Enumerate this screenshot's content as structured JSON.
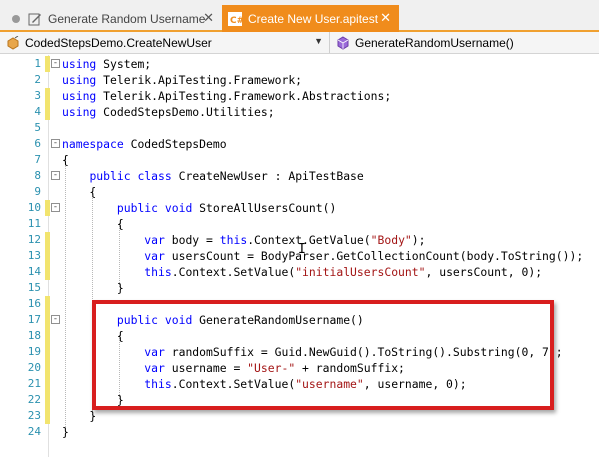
{
  "tabs": [
    {
      "label": "Generate Random Username",
      "active": false
    },
    {
      "label": "Create New User.apitest",
      "active": true
    }
  ],
  "navbar": {
    "class_selector": "CodedStepsDemo.CreateNewUser",
    "member_selector": "GenerateRandomUsername()"
  },
  "colors": {
    "accent": "#f08c1c",
    "keyword": "#0000ff",
    "string": "#a31515",
    "line_number": "#2b91af",
    "highlight": "#d81e1e",
    "changed_marker": "#f2e46e"
  },
  "lines": [
    {
      "num": "1",
      "changed": true,
      "fold": "-",
      "tokens": [
        {
          "t": "using",
          "k": "kw"
        },
        {
          "t": " System;"
        }
      ]
    },
    {
      "num": "2",
      "changed": false,
      "fold": "",
      "tokens": [
        {
          "t": "using",
          "k": "kw"
        },
        {
          "t": " Telerik.ApiTesting.Framework;"
        }
      ]
    },
    {
      "num": "3",
      "changed": true,
      "fold": "",
      "tokens": [
        {
          "t": "using",
          "k": "kw"
        },
        {
          "t": " Telerik.ApiTesting.Framework.Abstractions;"
        }
      ]
    },
    {
      "num": "4",
      "changed": true,
      "fold": "",
      "tokens": [
        {
          "t": "using",
          "k": "kw"
        },
        {
          "t": " CodedStepsDemo.Utilities;"
        }
      ]
    },
    {
      "num": "5",
      "changed": false,
      "fold": "",
      "tokens": []
    },
    {
      "num": "6",
      "changed": false,
      "fold": "-",
      "tokens": [
        {
          "t": "namespace",
          "k": "kw"
        },
        {
          "t": " CodedStepsDemo"
        }
      ]
    },
    {
      "num": "7",
      "changed": false,
      "fold": "",
      "tokens": [
        {
          "t": "{"
        }
      ]
    },
    {
      "num": "8",
      "changed": false,
      "fold": "-",
      "tokens": [
        {
          "t": "    "
        },
        {
          "t": "public",
          "k": "kw"
        },
        {
          "t": " "
        },
        {
          "t": "class",
          "k": "kw"
        },
        {
          "t": " CreateNewUser : ApiTestBase"
        }
      ]
    },
    {
      "num": "9",
      "changed": false,
      "fold": "",
      "tokens": [
        {
          "t": "    {"
        }
      ]
    },
    {
      "num": "10",
      "changed": true,
      "fold": "-",
      "tokens": [
        {
          "t": "        "
        },
        {
          "t": "public",
          "k": "kw"
        },
        {
          "t": " "
        },
        {
          "t": "void",
          "k": "kw"
        },
        {
          "t": " StoreAllUsersCount()"
        }
      ]
    },
    {
      "num": "11",
      "changed": false,
      "fold": "",
      "tokens": [
        {
          "t": "        {"
        }
      ]
    },
    {
      "num": "12",
      "changed": true,
      "fold": "",
      "tokens": [
        {
          "t": "            "
        },
        {
          "t": "var",
          "k": "kw"
        },
        {
          "t": " body = "
        },
        {
          "t": "this",
          "k": "kw"
        },
        {
          "t": ".Context.GetValue("
        },
        {
          "t": "\"Body\"",
          "k": "str"
        },
        {
          "t": ");"
        }
      ]
    },
    {
      "num": "13",
      "changed": true,
      "fold": "",
      "tokens": [
        {
          "t": "            "
        },
        {
          "t": "var",
          "k": "kw"
        },
        {
          "t": " usersCount = BodyParser.GetCollectionCount(body.ToString());"
        }
      ]
    },
    {
      "num": "14",
      "changed": true,
      "fold": "",
      "tokens": [
        {
          "t": "            "
        },
        {
          "t": "this",
          "k": "kw"
        },
        {
          "t": ".Context.SetValue("
        },
        {
          "t": "\"initialUsersCount\"",
          "k": "str"
        },
        {
          "t": ", usersCount, 0);"
        }
      ]
    },
    {
      "num": "15",
      "changed": false,
      "fold": "",
      "tokens": [
        {
          "t": "        }"
        }
      ]
    },
    {
      "num": "16",
      "changed": true,
      "fold": "",
      "tokens": []
    },
    {
      "num": "17",
      "changed": true,
      "fold": "-",
      "tokens": [
        {
          "t": "        "
        },
        {
          "t": "public",
          "k": "kw"
        },
        {
          "t": " "
        },
        {
          "t": "void",
          "k": "kw"
        },
        {
          "t": " GenerateRandomUsername()"
        }
      ]
    },
    {
      "num": "18",
      "changed": true,
      "fold": "",
      "tokens": [
        {
          "t": "        {"
        }
      ]
    },
    {
      "num": "19",
      "changed": true,
      "fold": "",
      "tokens": [
        {
          "t": "            "
        },
        {
          "t": "var",
          "k": "kw"
        },
        {
          "t": " randomSuffix = Guid.NewGuid().ToString().Substring(0, 7);"
        }
      ]
    },
    {
      "num": "20",
      "changed": true,
      "fold": "",
      "tokens": [
        {
          "t": "            "
        },
        {
          "t": "var",
          "k": "kw"
        },
        {
          "t": " username = "
        },
        {
          "t": "\"User-\"",
          "k": "str"
        },
        {
          "t": " + randomSuffix;"
        }
      ]
    },
    {
      "num": "21",
      "changed": true,
      "fold": "",
      "tokens": [
        {
          "t": "            "
        },
        {
          "t": "this",
          "k": "kw"
        },
        {
          "t": ".Context.SetValue("
        },
        {
          "t": "\"username\"",
          "k": "str"
        },
        {
          "t": ", username, 0);"
        }
      ]
    },
    {
      "num": "22",
      "changed": true,
      "fold": "",
      "tokens": [
        {
          "t": "        }"
        }
      ]
    },
    {
      "num": "23",
      "changed": true,
      "fold": "",
      "tokens": [
        {
          "t": "    }"
        }
      ]
    },
    {
      "num": "24",
      "changed": false,
      "fold": "",
      "tokens": [
        {
          "t": "}"
        }
      ]
    }
  ]
}
